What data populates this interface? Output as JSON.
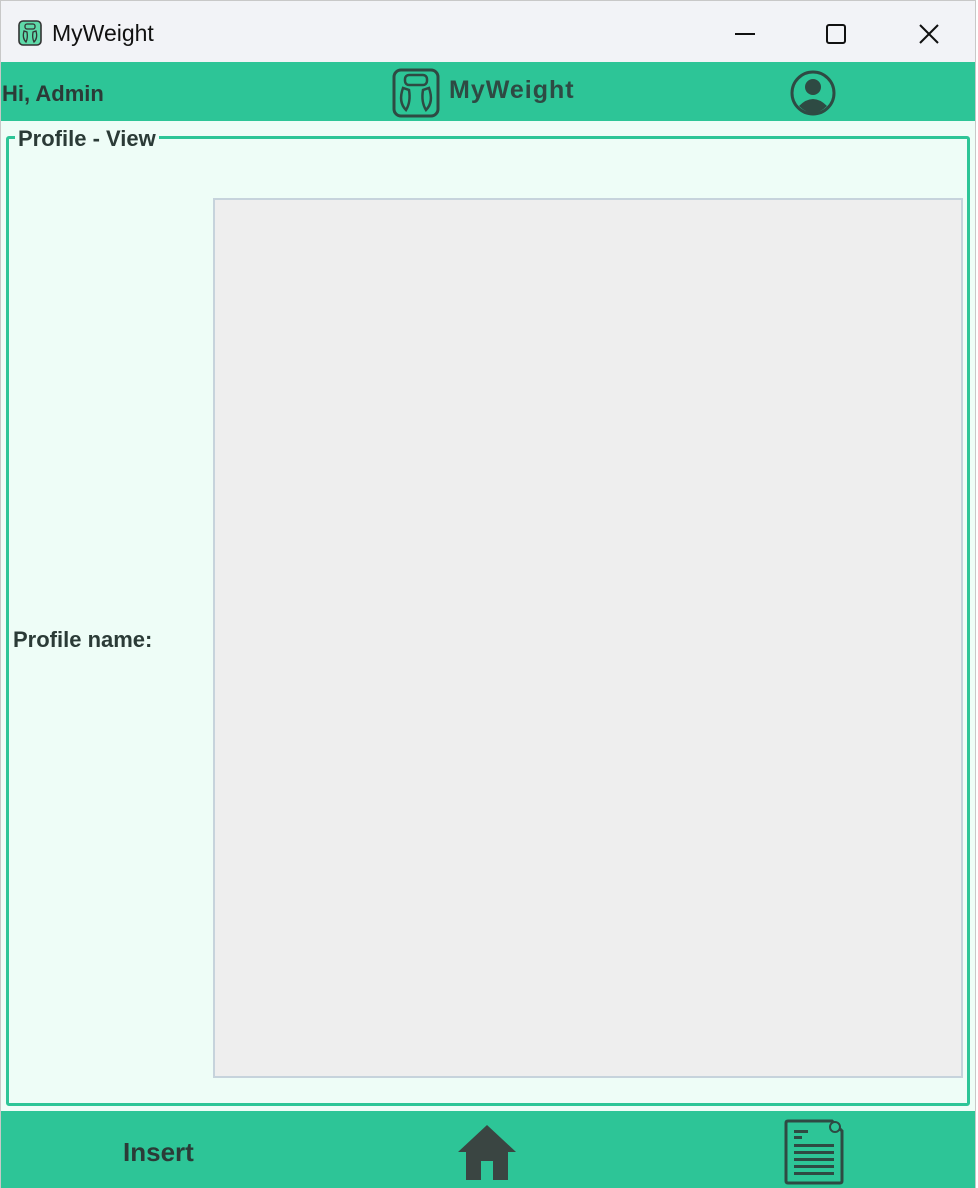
{
  "window": {
    "title": "MyWeight",
    "app_icon": "scale-icon",
    "controls": [
      "minimize-icon",
      "maximize-icon",
      "close-icon"
    ]
  },
  "header": {
    "greeting": "Hi, Admin",
    "logo_text": "MyWeight",
    "logo_icon": "scale-icon",
    "profile_icon": "user-circle-icon"
  },
  "profile": {
    "legend": "Profile - View",
    "name_label": "Profile name:",
    "name_value": ""
  },
  "footer": {
    "insert_label": "Insert",
    "home_icon": "home-icon",
    "report_icon": "document-icon"
  },
  "colors": {
    "accent": "#2dc597",
    "text": "#2b3b37",
    "panel_background": "#eefdf7",
    "field_background": "#eeeeee"
  }
}
